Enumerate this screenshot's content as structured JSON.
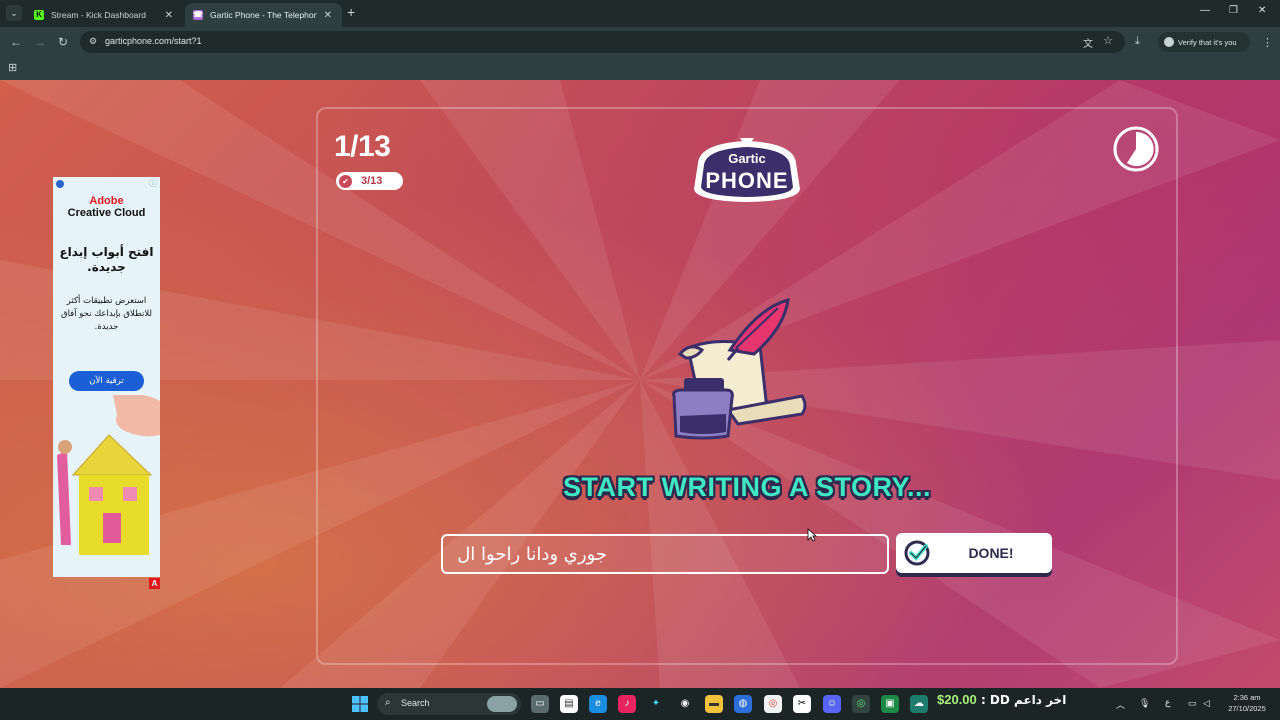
{
  "browser": {
    "tabs": [
      {
        "label": "Stream - Kick Dashboard",
        "active": false,
        "favicon": "kick-icon"
      },
      {
        "label": "Gartic Phone - The Telephone G",
        "active": true,
        "favicon": "gartic-icon"
      }
    ],
    "url": "garticphone.com/start?1",
    "profile_text": "Verify that it's you"
  },
  "game": {
    "round": "1/13",
    "players_done": "3/13",
    "logo_top": "Gartic",
    "logo_bottom": "PHONE",
    "headline": "START WRITING A STORY...",
    "story_value": "جوري ودانا راحوا ال",
    "done_label": "DONE!"
  },
  "ad": {
    "brand_line1": "Adobe",
    "brand_line2": "Creative Cloud",
    "headline": "افتح أبواب إبداع جديدة.",
    "body": "استعرض تطبيقات أكثر للانطلاق بإبداعك نحو آفاق جديدة.",
    "cta": "ترقية الآن",
    "badge": "A"
  },
  "taskbar": {
    "search_label": "Search",
    "donation_amount": "$20.00",
    "donation_text": " : DD اخر داعم",
    "language": "ع",
    "time": "2:36 am",
    "date": "27/10/2025"
  },
  "colors": {
    "accent": "#3fe8c3",
    "navy": "#2d2a4e",
    "pink": "#e6356f"
  }
}
